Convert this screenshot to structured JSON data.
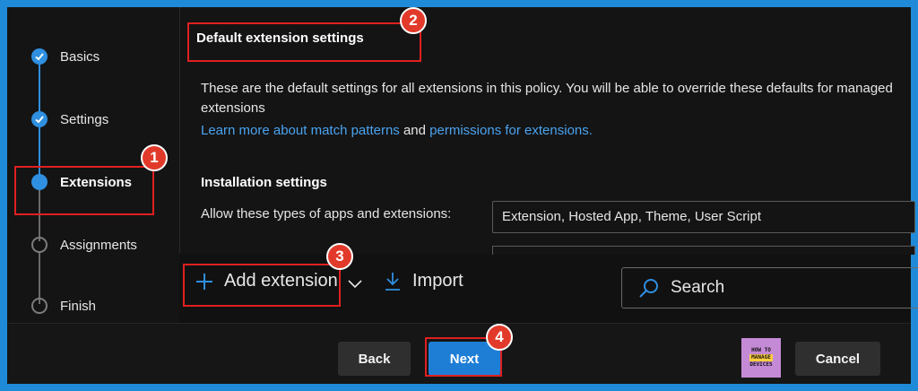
{
  "steps": [
    {
      "label": "Basics",
      "state": "done"
    },
    {
      "label": "Settings",
      "state": "done"
    },
    {
      "label": "Extensions",
      "state": "current"
    },
    {
      "label": "Assignments",
      "state": "todo"
    },
    {
      "label": "Finish",
      "state": "todo"
    }
  ],
  "content": {
    "section_title": "Default extension settings",
    "description": "These are the default settings for all extensions in this policy. You will be able to override these defaults for managed extensions",
    "learn_more_link": "Learn more about match patterns",
    "and_text": "and",
    "permissions_link": "permissions for extensions.",
    "installation_title": "Installation settings",
    "allow_label": "Allow these types of apps and extensions:",
    "allow_value": "Extension, Hosted App, Theme, User Script"
  },
  "toolbar": {
    "add_extension": "Add extension",
    "import": "Import",
    "search_placeholder": "Search"
  },
  "footer": {
    "back": "Back",
    "next": "Next",
    "cancel": "Cancel"
  },
  "logo": {
    "line1": "HOW TO",
    "line2": "MANAGE",
    "line3": "DEVICES"
  },
  "annotations": [
    "1",
    "2",
    "3",
    "4"
  ],
  "colors": {
    "accent": "#1e7ed6",
    "highlight": "#e02020",
    "link": "#4aa3f0",
    "background": "#111111"
  }
}
